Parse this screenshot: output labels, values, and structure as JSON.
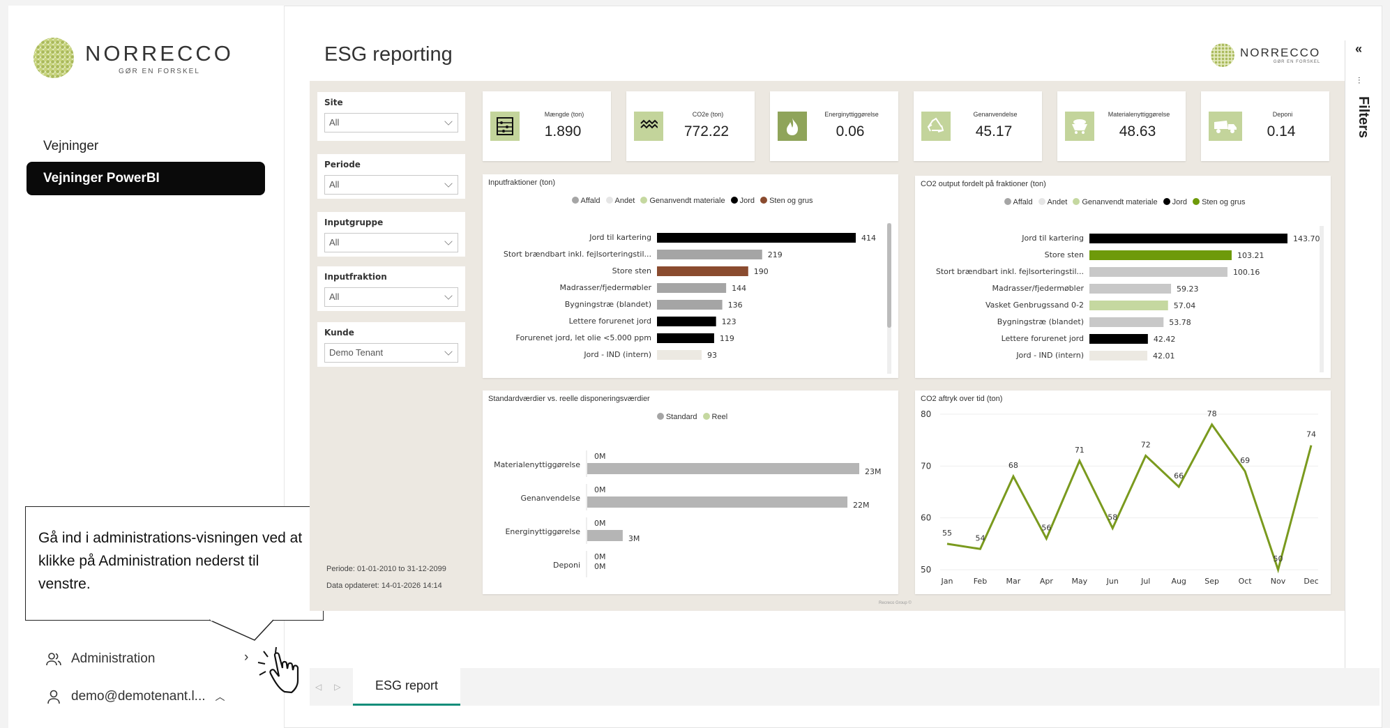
{
  "sidebar": {
    "logo_name": "NORRECCO",
    "logo_tag": "GØR EN FORSKEL",
    "nav": [
      {
        "label": "Vejninger"
      },
      {
        "label": "Vejninger PowerBI"
      }
    ],
    "admin_label": "Administration",
    "user_label": "demo@demotenant.l..."
  },
  "callout": {
    "text": "Gå ind i administrations-visningen ved at klikke på Administration nederst til venstre."
  },
  "report": {
    "title": "ESG reporting",
    "brand": "NORRECCO",
    "brand_tag": "GØR EN FORSKEL",
    "filters_label": "Filters",
    "tab_label": "ESG report",
    "footer": "Recreco Group ©",
    "period": "Periode: 01-01-2010 to 31-12-2099",
    "updated": "Data opdateret: 14-01-2026 14:14"
  },
  "slicers": [
    {
      "label": "Site",
      "value": "All"
    },
    {
      "label": "Periode",
      "value": "All"
    },
    {
      "label": "Inputgruppe",
      "value": "All"
    },
    {
      "label": "Inputfraktion",
      "value": "All"
    },
    {
      "label": "Kunde",
      "value": "Demo Tenant"
    }
  ],
  "kpis": [
    {
      "label": "Mængde (ton)",
      "value": "1.890",
      "icon": "abacus-icon"
    },
    {
      "label": "CO2e (ton)",
      "value": "772.22",
      "icon": "waves-icon"
    },
    {
      "label": "Energinyttiggørelse",
      "value": "0.06",
      "icon": "flame-icon"
    },
    {
      "label": "Genanvendelse",
      "value": "45.17",
      "icon": "recycle-icon"
    },
    {
      "label": "Materialenyttiggørelse",
      "value": "48.63",
      "icon": "mining-cart-icon"
    },
    {
      "label": "Deponi",
      "value": "0.14",
      "icon": "dump-truck-icon"
    }
  ],
  "colors": {
    "affald": "#a5a5a5",
    "andet": "#e5e5e5",
    "genanvendt": "#c5d8a0",
    "jord": "#000000",
    "sten_og_grus": "#8a4b2f",
    "sten_og_grus_co2": "#6e9a0a",
    "line": "#7a9a1e",
    "light_bar": "#ece9e2",
    "mid_grey": "#c8c8c8"
  },
  "chart_data": [
    {
      "type": "bar",
      "title": "Inputfraktioner (ton)",
      "legend": [
        "Affald",
        "Andet",
        "Genanvendt materiale",
        "Jord",
        "Sten og grus"
      ],
      "categories": [
        "Jord til kartering",
        "Stort brændbart inkl. fejlsorteringstil...",
        "Store sten",
        "Madrasser/fjedermøbler",
        "Bygningstræ (blandet)",
        "Lettere forurenet jord",
        "Forurenet jord, let olie <5.000 ppm",
        "Jord - IND (intern)"
      ],
      "values": [
        414,
        219,
        190,
        144,
        136,
        123,
        119,
        93
      ],
      "bar_colors": [
        "#000000",
        "#a5a5a5",
        "#8a4b2f",
        "#a5a5a5",
        "#a5a5a5",
        "#000000",
        "#000000",
        "#ece9e2"
      ]
    },
    {
      "type": "bar",
      "title": "CO2 output fordelt på fraktioner (ton)",
      "legend": [
        "Affald",
        "Andet",
        "Genanvendt materiale",
        "Jord",
        "Sten og grus"
      ],
      "categories": [
        "Jord til kartering",
        "Store sten",
        "Stort brændbart inkl. fejlsorteringstil...",
        "Madrasser/fjedermøbler",
        "Vasket Genbrugssand 0-2",
        "Bygningstræ (blandet)",
        "Lettere forurenet jord",
        "Jord - IND (intern)"
      ],
      "values": [
        143.7,
        103.21,
        100.16,
        59.23,
        57.04,
        53.78,
        42.42,
        42.01
      ],
      "labels": [
        "143.70",
        "103.21",
        "100.16",
        "59.23",
        "57.04",
        "53.78",
        "42.42",
        "42.01"
      ],
      "bar_colors": [
        "#000000",
        "#6e9a0a",
        "#c8c8c8",
        "#c8c8c8",
        "#c5d8a0",
        "#c8c8c8",
        "#000000",
        "#ece9e2"
      ]
    },
    {
      "type": "bar",
      "title": "Standardværdier vs. reelle disponeringsværdier",
      "legend": [
        "Standard",
        "Reel"
      ],
      "categories": [
        "Materialenyttiggørelse",
        "Genanvendelse",
        "Energinyttiggørelse",
        "Deponi"
      ],
      "series": [
        {
          "name": "Standard",
          "values": [
            0,
            0,
            0,
            0
          ],
          "labels": [
            "0M",
            "0M",
            "0M",
            "0M"
          ]
        },
        {
          "name": "Reel",
          "values": [
            23,
            22,
            3,
            0
          ],
          "labels": [
            "23M",
            "22M",
            "3M",
            "0M"
          ]
        }
      ]
    },
    {
      "type": "line",
      "title": "CO2 aftryk over tid (ton)",
      "x": [
        "Jan",
        "Feb",
        "Mar",
        "Apr",
        "May",
        "Jun",
        "Jul",
        "Aug",
        "Sep",
        "Oct",
        "Nov",
        "Dec"
      ],
      "y": [
        55,
        54,
        68,
        56,
        71,
        58,
        72,
        66,
        78,
        69,
        50,
        74
      ],
      "yticks": [
        "80",
        "70",
        "60",
        "50"
      ],
      "ylim": [
        50,
        80
      ]
    }
  ]
}
